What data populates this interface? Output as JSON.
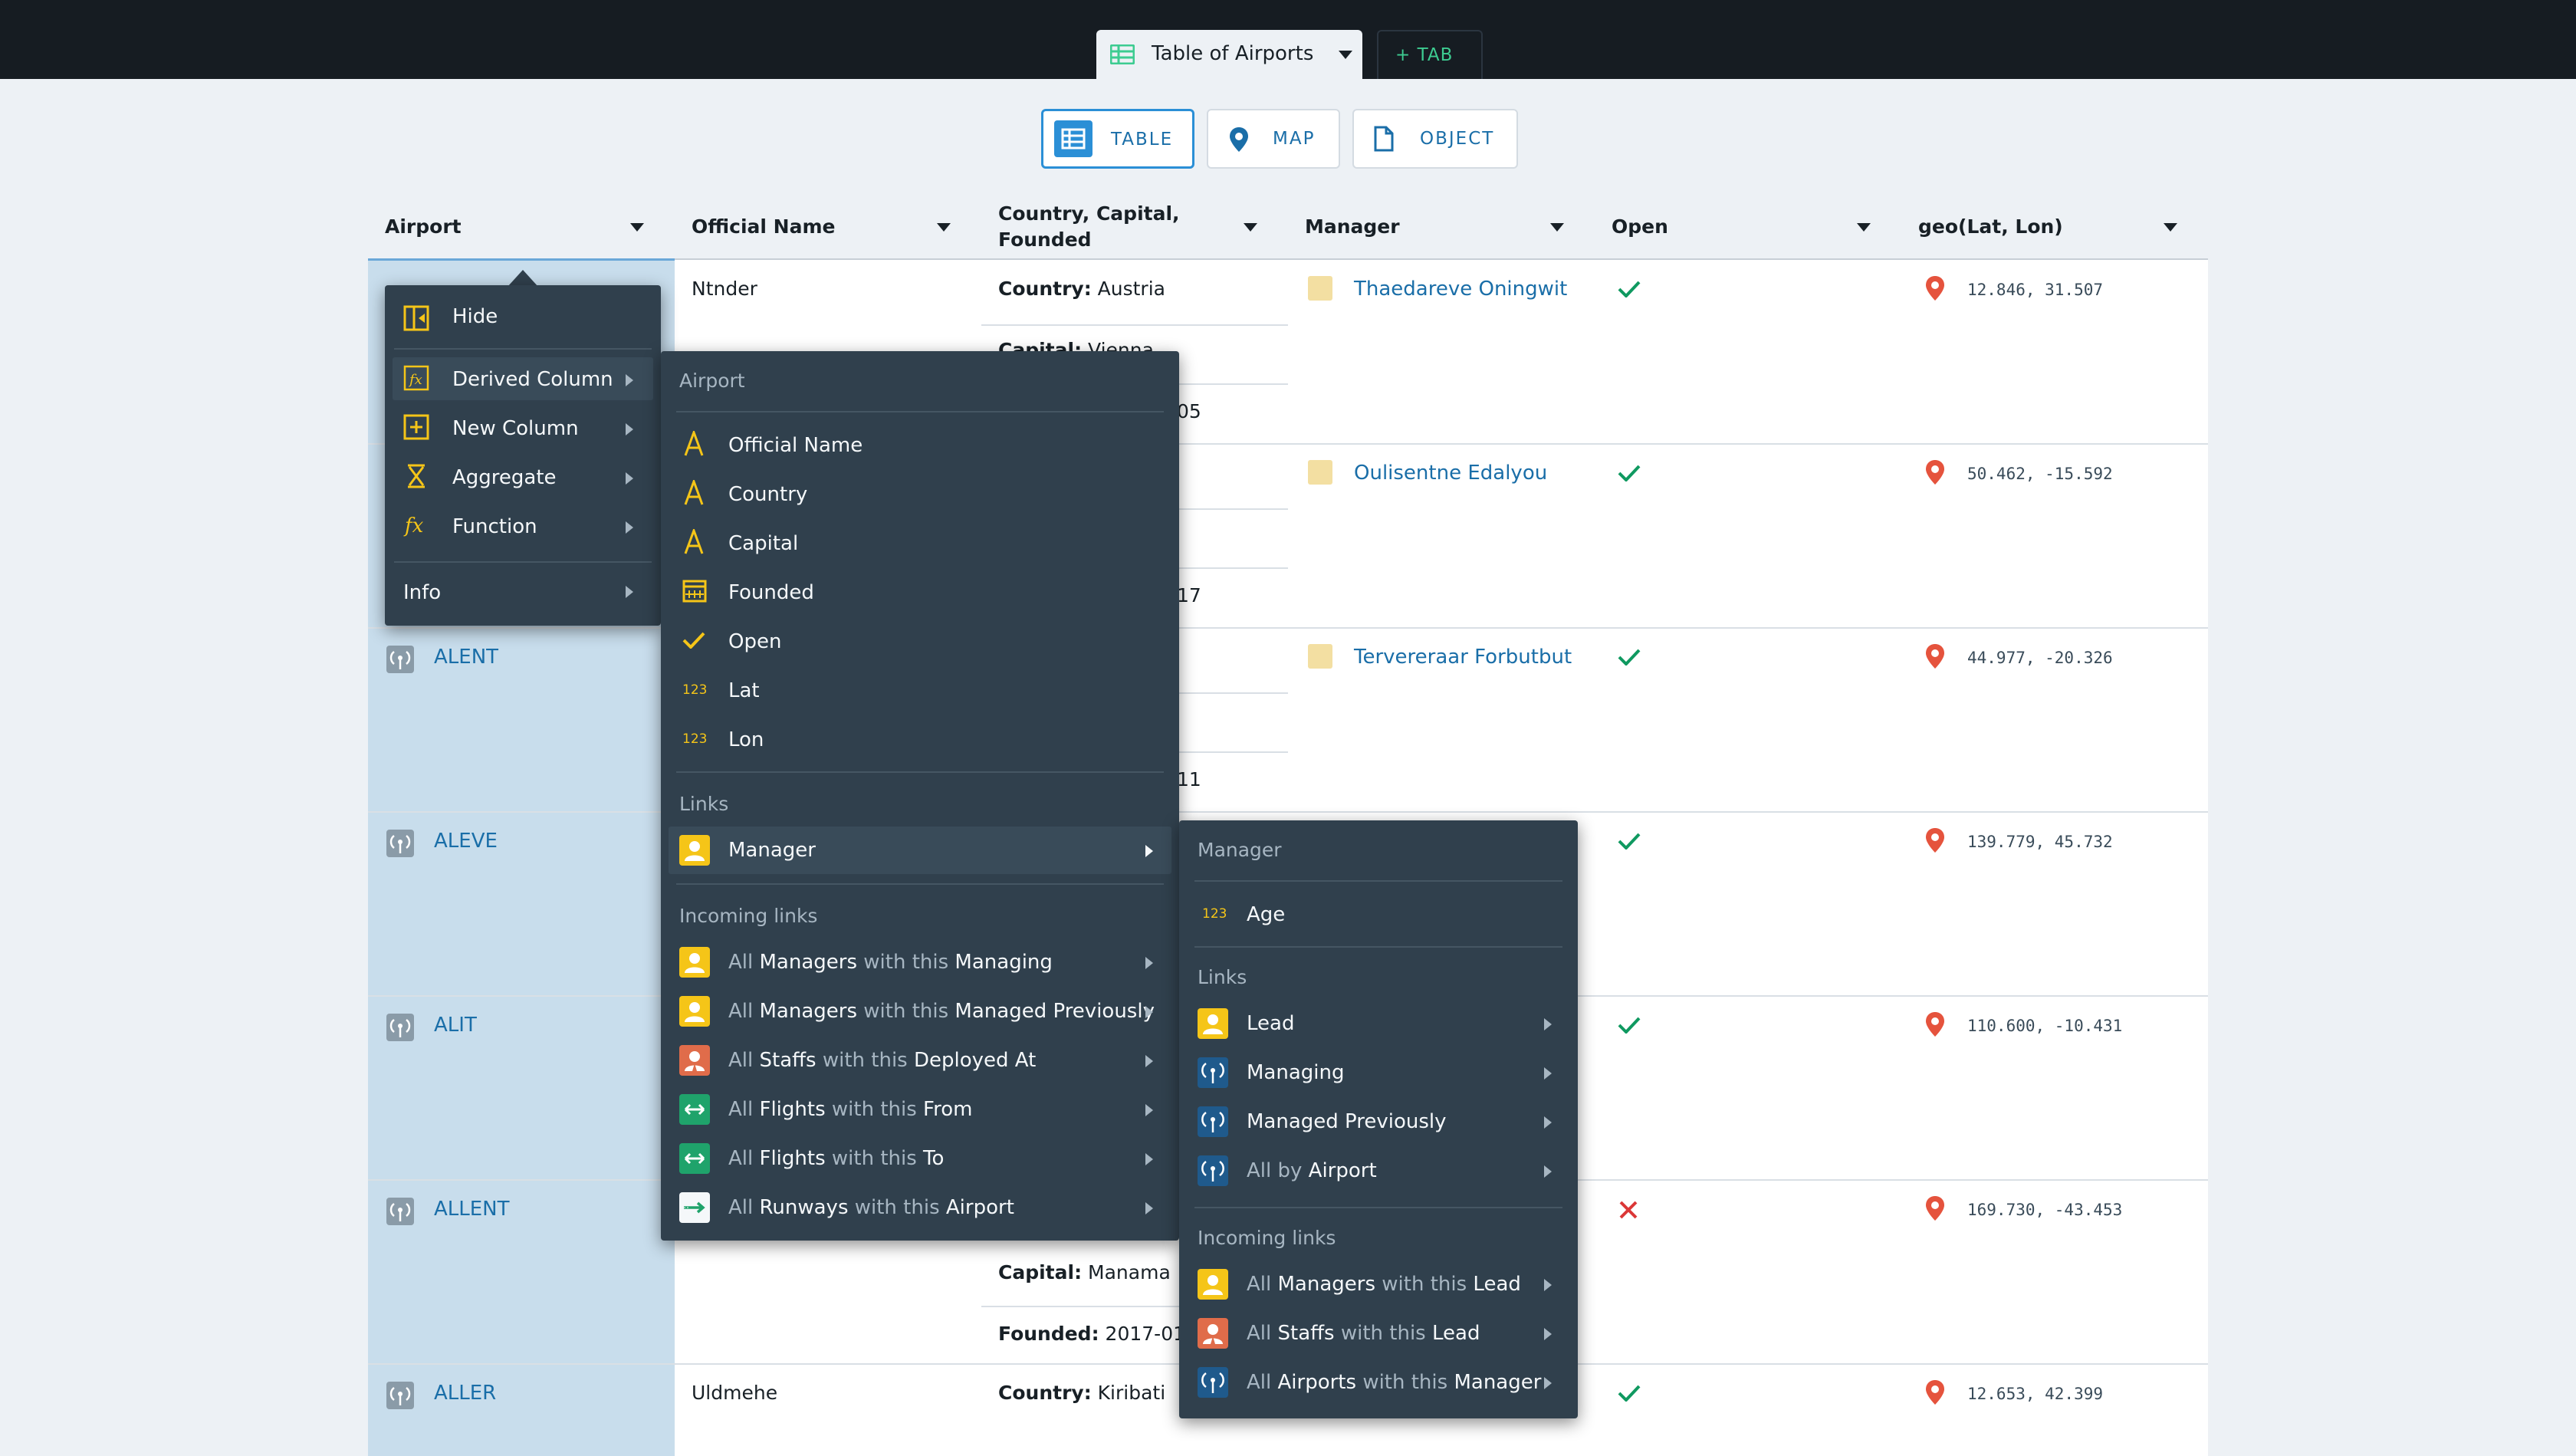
{
  "tabs": {
    "active_label": "Table of Airports",
    "add_label": "+ TAB"
  },
  "views": {
    "table": "TABLE",
    "map": "MAP",
    "object": "OBJECT"
  },
  "columns": [
    "Airport",
    "Official Name",
    "Country, Capital,",
    "Founded",
    "Manager",
    "Open",
    "geo(Lat, Lon)"
  ],
  "rows": [
    {
      "airport": "",
      "official_name": "Ntnder",
      "country_label": "Country:",
      "country": "Austria",
      "capital_label": "Capital:",
      "capital": "Vienna",
      "founded_tail": "05",
      "manager": "Thaedareve Oningwit",
      "open": true,
      "geo": "12.846, 31.507"
    },
    {
      "airport": "",
      "official_name": "",
      "founded_tail": "17",
      "manager": "Oulisentne Edalyou",
      "open": true,
      "geo": "50.462, -15.592"
    },
    {
      "airport": "ALENT",
      "official_name": "",
      "founded_tail": "11",
      "manager": "Tervereraar Forbutbut",
      "open": true,
      "geo": "44.977, -20.326"
    },
    {
      "airport": "ALEVE",
      "official_name": "",
      "manager": "",
      "open": true,
      "geo": "139.779, 45.732"
    },
    {
      "airport": "ALIT",
      "official_name": "",
      "manager": "",
      "open": true,
      "geo": "110.600, -10.431"
    },
    {
      "airport": "ALLENT",
      "official_name": "",
      "capital_label": "Capital:",
      "capital": "Manama",
      "founded_label": "Founded:",
      "founded": "2017-01-",
      "manager": "",
      "open": false,
      "geo": "169.730, -43.453"
    },
    {
      "airport": "ALLER",
      "official_name": "Uldmehe",
      "country_label": "Country:",
      "country": "Kiribati",
      "manager": "",
      "open": true,
      "geo": "12.653, 42.399"
    }
  ],
  "context_menu": {
    "hide": "Hide",
    "derived_column": "Derived Column",
    "new_column": "New Column",
    "aggregate": "Aggregate",
    "function": "Function",
    "info": "Info"
  },
  "derived_menu": {
    "section_airport": "Airport",
    "props": [
      "Official Name",
      "Country",
      "Capital",
      "Founded",
      "Open",
      "Lat",
      "Lon"
    ],
    "num_badge": "123",
    "section_links": "Links",
    "manager_link": "Manager",
    "section_incoming": "Incoming links",
    "incoming": [
      {
        "pre": "All",
        "obj": "Managers",
        "mid": "with this",
        "link": "Managing"
      },
      {
        "pre": "All",
        "obj": "Managers",
        "mid": "with this",
        "link": "Managed Previously"
      },
      {
        "pre": "All",
        "obj": "Staffs",
        "mid": "with this",
        "link": "Deployed At"
      },
      {
        "pre": "All",
        "obj": "Flights",
        "mid": "with this",
        "link": "From"
      },
      {
        "pre": "All",
        "obj": "Flights",
        "mid": "with this",
        "link": "To"
      },
      {
        "pre": "All",
        "obj": "Runways",
        "mid": "with this",
        "link": "Airport"
      }
    ]
  },
  "manager_menu": {
    "section_manager": "Manager",
    "age": "Age",
    "num_badge": "123",
    "section_links": "Links",
    "lead": "Lead",
    "managing": "Managing",
    "managed_previously": "Managed Previously",
    "all_by": "All by",
    "all_by_obj": "Airport",
    "section_incoming": "Incoming links",
    "incoming": [
      {
        "pre": "All",
        "obj": "Managers",
        "mid": "with this",
        "link": "Lead"
      },
      {
        "pre": "All",
        "obj": "Staffs",
        "mid": "with this",
        "link": "Lead"
      },
      {
        "pre": "All",
        "obj": "Airports",
        "mid": "with this",
        "link": "Manager"
      }
    ]
  },
  "colors": {
    "topbar": "#161c22",
    "accent_blue": "#1a6ea8",
    "menu_bg": "#30404d",
    "icon_yellow": "#f5c518",
    "check_green": "#0f9960",
    "cross_red": "#db3737",
    "pin_red": "#e5533d"
  }
}
